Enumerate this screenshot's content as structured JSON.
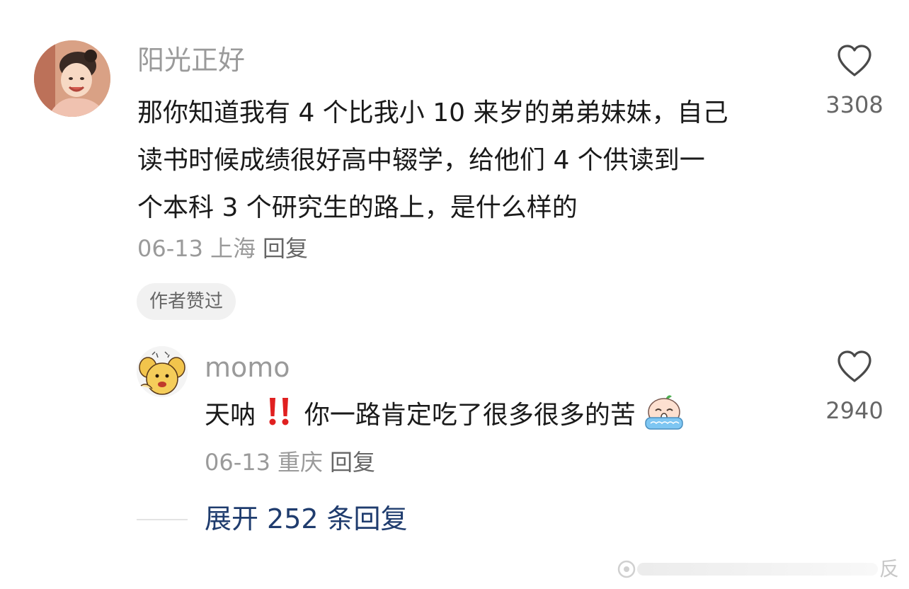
{
  "comment": {
    "username": "阳光正好",
    "text_lines": [
      "那你知道我有 4 个比我小 10 来岁的弟弟妹妹，自己",
      "读书时候成绩很好高中辍学，给他们 4 个供读到一",
      "个本科 3 个研究生的路上，是什么样的"
    ],
    "date": "06-13",
    "location": "上海",
    "reply_label": "回复",
    "badge": "作者赞过",
    "likes": "3308",
    "avatar_icon": "avatar-girl-photo"
  },
  "reply": {
    "username": "momo",
    "text_before": "天呐",
    "text_after": "你一路肯定吃了很多很多的苦",
    "date": "06-13",
    "location": "重庆",
    "reply_label": "回复",
    "likes": "2940",
    "avatar_icon": "avatar-cartoon-bear",
    "emoji_icons": [
      "double-exclamation-icon",
      "crying-face-icon"
    ]
  },
  "expand": {
    "prefix": "展开",
    "count": "252",
    "suffix": "条回复"
  },
  "watermark": {
    "visible_text": "反"
  },
  "colors": {
    "username": "#9a9a9a",
    "body_text": "#1a1a1a",
    "meta": "#9a9a9a",
    "link_blue": "#1f3c6e",
    "exclaim_red": "#e02020",
    "badge_bg": "#f1f1f1"
  }
}
